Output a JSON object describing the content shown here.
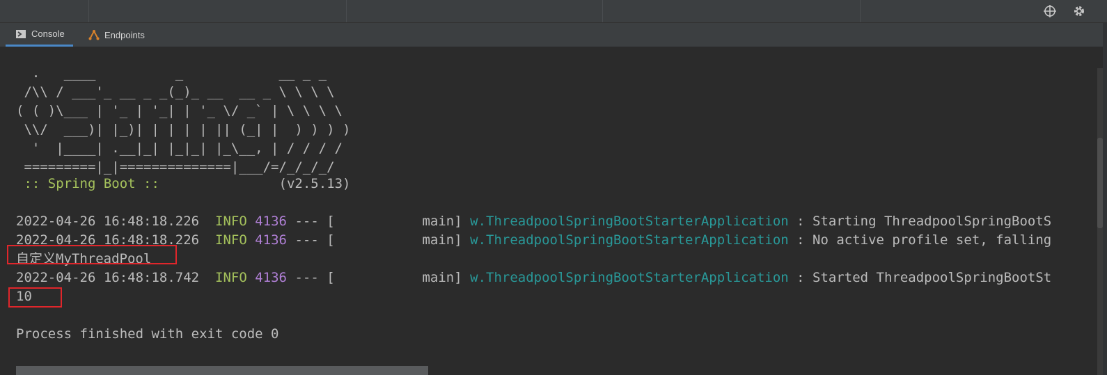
{
  "tabs": [
    {
      "label": "Console",
      "icon": "console-icon",
      "active": true
    },
    {
      "label": "Endpoints",
      "icon": "endpoints-icon",
      "active": false
    }
  ],
  "toolbar_icons": [
    "crosshair-icon",
    "gear-icon"
  ],
  "console": {
    "banner": [
      "  .   ____          _            __ _ _",
      " /\\\\ / ___'_ __ _ _(_)_ __  __ _ \\ \\ \\ \\",
      "( ( )\\___ | '_ | '_| | '_ \\/ _` | \\ \\ \\ \\",
      " \\\\/  ___)| |_)| | | | | || (_| |  ) ) ) )",
      "  '  |____| .__|_| |_|_| |_\\__, | / / / /",
      " =========|_|==============|___/=/_/_/_/"
    ],
    "spring_label": " :: Spring Boot ::",
    "spring_version": "(v2.5.13)",
    "logs": [
      {
        "timestamp": "2022-04-26 16:48:18.226",
        "level": "INFO",
        "pid": "4136",
        "sep": "--- [",
        "thread": "main]",
        "logger": "w.ThreadpoolSpringBootStarterApplication",
        "message": ": Starting ThreadpoolSpringBootS"
      },
      {
        "timestamp": "2022-04-26 16:48:18.226",
        "level": "INFO",
        "pid": "4136",
        "sep": "--- [",
        "thread": "main]",
        "logger": "w.ThreadpoolSpringBootStarterApplication",
        "message": ": No active profile set, falling"
      },
      {
        "timestamp": "2022-04-26 16:48:18.742",
        "level": "INFO",
        "pid": "4136",
        "sep": "--- [",
        "thread": "main]",
        "logger": "w.ThreadpoolSpringBootStarterApplication",
        "message": ": Started ThreadpoolSpringBootSt"
      }
    ],
    "custom_output": "自定义MyThreadPool",
    "number_output": "10",
    "exit_message": "Process finished with exit code 0"
  },
  "colors": {
    "background": "#2b2b2b",
    "info": "#a5c25c",
    "pid": "#b180d7",
    "logger": "#299999",
    "highlight_box": "#e0262b"
  }
}
